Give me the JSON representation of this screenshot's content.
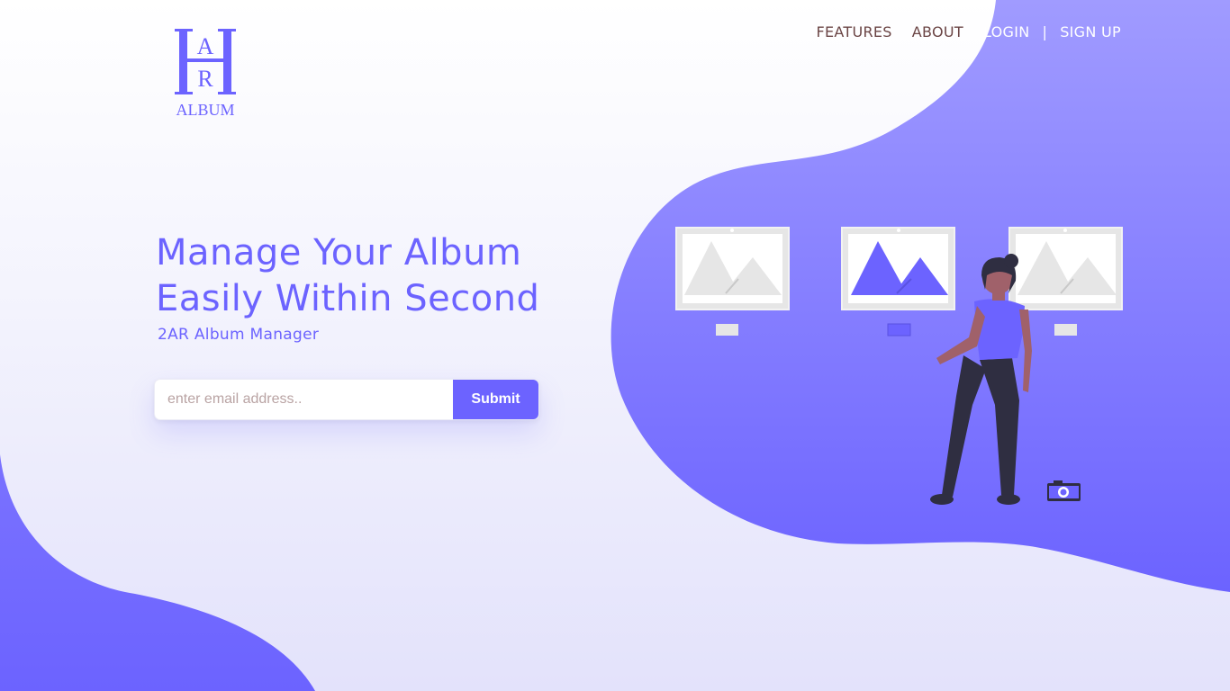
{
  "brand": {
    "logo_letters": [
      "A",
      "R"
    ],
    "logo_text": "ALBUM"
  },
  "nav": {
    "features": "FEATURES",
    "about": "ABOUT",
    "login": "LOGIN",
    "separator": "|",
    "signup": "SIGN UP"
  },
  "hero": {
    "title": "Manage Your Album\nEasily Within Second",
    "subtitle": "2AR Album Manager"
  },
  "form": {
    "email_placeholder": "enter email address..",
    "email_value": "",
    "submit_label": "Submit"
  },
  "colors": {
    "accent": "#6c63ff",
    "blob_top": "#a09bff",
    "nav_dark": "#6b4545",
    "frame_gray": "#e6e6e6",
    "figure_dark": "#2f2e41",
    "skin": "#a0616a"
  },
  "icons": {
    "camera": "camera-icon"
  }
}
